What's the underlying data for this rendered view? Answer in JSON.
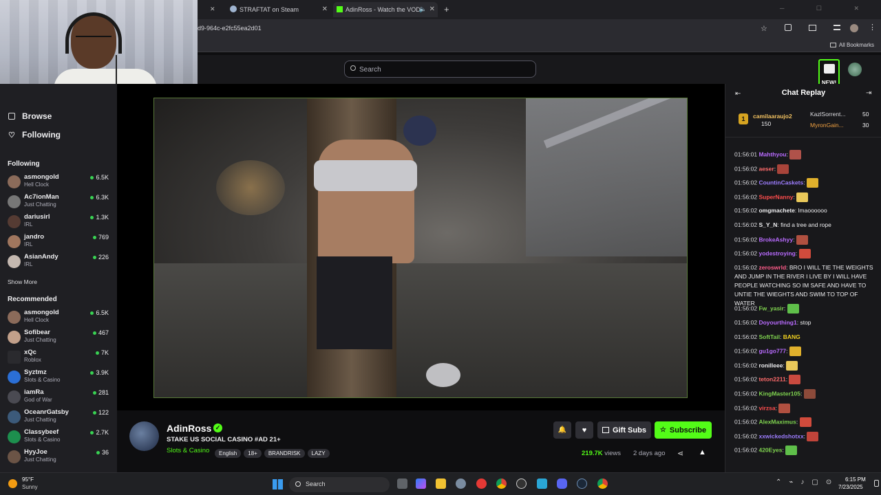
{
  "browser": {
    "tabs": [
      {
        "title": "STRAFTAT on Steam"
      },
      {
        "title": "AdinRoss - Watch the VOD"
      }
    ],
    "address": "d9-964c-e2fc55ea2d01",
    "bookmarks_label": "All Bookmarks"
  },
  "topnav": {
    "search_placeholder": "Search",
    "new_badge": "NEW!"
  },
  "sidebar": {
    "browse": "Browse",
    "following": "Following",
    "following_header": "Following",
    "following_channels": [
      {
        "name": "asmongold",
        "category": "Hell Clock",
        "viewers": "6.5K"
      },
      {
        "name": "Ac7ionMan",
        "category": "Just Chatting",
        "viewers": "6.3K"
      },
      {
        "name": "dariusirl",
        "category": "IRL",
        "viewers": "1.3K"
      },
      {
        "name": "jandro",
        "category": "IRL",
        "viewers": "769"
      },
      {
        "name": "AsianAndy",
        "category": "IRL",
        "viewers": "226"
      }
    ],
    "show_more": "Show More",
    "recommended_header": "Recommended",
    "recommended_channels": [
      {
        "name": "asmongold",
        "category": "Hell Clock",
        "viewers": "6.5K"
      },
      {
        "name": "Sofibear",
        "category": "Just Chatting",
        "viewers": "467"
      },
      {
        "name": "xQc",
        "category": "Roblox",
        "viewers": "7K"
      },
      {
        "name": "Syztmz",
        "category": "Slots & Casino",
        "viewers": "3.9K"
      },
      {
        "name": "iamRa",
        "category": "God of War",
        "viewers": "281"
      },
      {
        "name": "OceanrGatsby",
        "category": "Just Chatting",
        "viewers": "122"
      },
      {
        "name": "Classybeef",
        "category": "Slots & Casino",
        "viewers": "2.7K"
      },
      {
        "name": "HyyJoe",
        "category": "Just Chatting",
        "viewers": "36"
      }
    ]
  },
  "channel": {
    "name": "AdinRoss",
    "title": "STAKE US SOCIAL CASINO #AD 21+",
    "category": "Slots & Casino",
    "tags": [
      "English",
      "18+",
      "BRANDRISK",
      "LAZY"
    ],
    "views": "219.7K",
    "views_label": "views",
    "age": "2 days ago",
    "gift_subs": "Gift Subs",
    "subscribe": "Subscribe"
  },
  "chat": {
    "header": "Chat Replay",
    "leaderboard": {
      "first": {
        "rank": "1",
        "name": "camilaaraujo2",
        "points": "150"
      },
      "second": {
        "name": "KazlSorrent...",
        "points": "50"
      },
      "third": {
        "name": "MyronGain...",
        "points": "30"
      }
    },
    "messages": [
      {
        "ts": "01:56:01",
        "user": "Mahthyou",
        "color": "#b96bff",
        "text": ""
      },
      {
        "ts": "01:56:02",
        "user": "aeser",
        "color": "#ff6b6b",
        "text": ""
      },
      {
        "ts": "01:56:02",
        "user": "CountinCaskets",
        "color": "#9d7dff",
        "text": ""
      },
      {
        "ts": "01:56:02",
        "user": "SuperNanny",
        "color": "#ff4d4d",
        "text": ""
      },
      {
        "ts": "01:56:02",
        "user": "omgmachete",
        "color": "#efeff1",
        "text": "lmaoooooo"
      },
      {
        "ts": "01:56:02",
        "user": "S_Y_N",
        "color": "#efeff1",
        "text": "find a tree and rope"
      },
      {
        "ts": "01:56:02",
        "user": "BrokeAshyy",
        "color": "#b96bff",
        "text": ""
      },
      {
        "ts": "01:56:02",
        "user": "yodestroying",
        "color": "#b96bff",
        "text": ""
      },
      {
        "ts": "01:56:02",
        "user": "zeroswrld",
        "color": "#ff5c8a",
        "text": "BRO I WILL TIE THE WEIGHTS AND JUMP IN THE RIVER I LIVE BY I WILL HAVE PEOPLE WATCHING SO IM SAFE AND HAVE TO UNTIE THE WIEGHTS AND SWIM TO TOP OF WATER"
      },
      {
        "ts": "01:56:02",
        "user": "Fw_yasir",
        "color": "#7fd34f",
        "text": ""
      },
      {
        "ts": "01:56:02",
        "user": "Doyourthing1",
        "color": "#b96bff",
        "text": "stop"
      },
      {
        "ts": "01:56:02",
        "user": "SoftTail",
        "color": "#7fd34f",
        "text": ""
      },
      {
        "ts": "01:56:02",
        "user": "gu1go777",
        "color": "#b96bff",
        "text": ""
      },
      {
        "ts": "01:56:02",
        "user": "ronilleee",
        "color": "#efeff1",
        "text": ""
      },
      {
        "ts": "01:56:02",
        "user": "teton2211",
        "color": "#ff6b6b",
        "text": ""
      },
      {
        "ts": "01:56:02",
        "user": "KingMaster105",
        "color": "#7fd34f",
        "text": ""
      },
      {
        "ts": "01:56:02",
        "user": "virzsa",
        "color": "#ff4d4d",
        "text": ""
      },
      {
        "ts": "01:56:02",
        "user": "AlexMaximus",
        "color": "#7fd34f",
        "text": ""
      },
      {
        "ts": "01:56:02",
        "user": "xxwickedshotxx",
        "color": "#9d7dff",
        "text": ""
      },
      {
        "ts": "01:56:02",
        "user": "420Eyes",
        "color": "#7fd34f",
        "text": ""
      }
    ],
    "emote_text": "BANG"
  },
  "taskbar": {
    "weather_temp": "95°F",
    "weather_desc": "Sunny",
    "search": "Search",
    "time": "6:15 PM",
    "date": "7/23/2025"
  },
  "colors": {
    "twitch_purple": "#9147ff",
    "subscribe_green": "#00c853",
    "live_dot": "#39d353"
  }
}
